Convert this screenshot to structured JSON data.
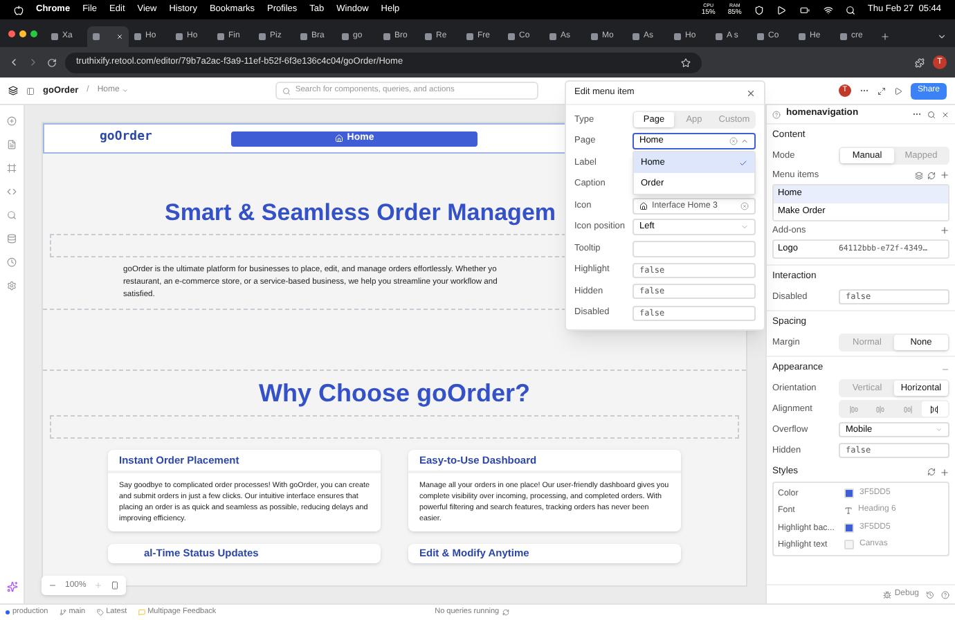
{
  "menubar": {
    "app": "Chrome",
    "menus": [
      "File",
      "Edit",
      "View",
      "History",
      "Bookmarks",
      "Profiles",
      "Tab",
      "Window",
      "Help"
    ],
    "cpu_label": "CPU",
    "cpu": "15%",
    "ram_label": "RAM",
    "ram": "85%",
    "clock": "Thu Feb 27  05:44"
  },
  "tabs": [
    {
      "label": "Xa",
      "selected": false
    },
    {
      "selected": true
    },
    {
      "label": "Ho",
      "selected": false
    },
    {
      "label": "Ho",
      "selected": false
    },
    {
      "label": "Fin",
      "selected": false
    },
    {
      "label": "Piz",
      "selected": false
    },
    {
      "label": "Bra",
      "selected": false
    },
    {
      "label": "go",
      "selected": false
    },
    {
      "label": "Bro",
      "selected": false
    },
    {
      "label": "Re",
      "selected": false
    },
    {
      "label": "Fre",
      "selected": false
    },
    {
      "label": "Co",
      "selected": false
    },
    {
      "label": "As",
      "selected": false
    },
    {
      "label": "Mo",
      "selected": false
    },
    {
      "label": "As",
      "selected": false
    },
    {
      "label": "Ho",
      "selected": false
    },
    {
      "label": "A s",
      "selected": false
    },
    {
      "label": "Co",
      "selected": false
    },
    {
      "label": "He",
      "selected": false
    },
    {
      "label": "cre",
      "selected": false
    }
  ],
  "address": "truthixify.retool.com/editor/79b7a2ac-f3a9-11ef-b52f-6f3e136c4c04/goOrder/Home",
  "profile_initial": "T",
  "editor": {
    "app_name": "goOrder",
    "separator": "/",
    "page": "Home",
    "search_placeholder": "Search for components, queries, and actions",
    "user_initial": "T",
    "share": "Share"
  },
  "canvas": {
    "logo": "goOrder",
    "nav_button": "Home",
    "hero_title": "Smart & Seamless Order Managem",
    "intro_lines": [
      "goOrder is the ultimate platform for businesses to place, edit, and manage orders effortlessly. Whether yo",
      "restaurant, an e-commerce store, or a service-based business, we help you streamline your workflow and",
      "satisfied."
    ],
    "section_title": "Why Choose goOrder?",
    "cards": [
      {
        "title": "Instant Order Placement",
        "body": "Say goodbye to complicated order processes! With goOrder, you can create and submit orders in just a few clicks. Our intuitive interface ensures that placing an order is as quick and seamless as possible, reducing delays and improving efficiency."
      },
      {
        "title": "Easy-to-Use Dashboard",
        "body": "Manage all your orders in one place! Our user-friendly dashboard gives you complete visibility over incoming, processing, and completed orders. With powerful filtering and search features, tracking orders has never been easier."
      }
    ],
    "next_cards": [
      "al-Time Status Updates",
      "Edit & Modify Anytime"
    ],
    "zoom": "100%"
  },
  "popup": {
    "title": "Edit menu item",
    "fields": [
      {
        "kind": "segmented",
        "label": "Type",
        "options": [
          {
            "label": "Page",
            "selected": true
          },
          {
            "label": "App",
            "selected": false
          },
          {
            "label": "Custom",
            "selected": false
          }
        ]
      },
      {
        "kind": "combo",
        "label": "Page",
        "value": "Home",
        "expanded": true,
        "options": [
          {
            "label": "Home",
            "selected": true
          },
          {
            "label": "Order",
            "selected": false
          }
        ]
      },
      {
        "kind": "covered",
        "label": "Label"
      },
      {
        "kind": "covered",
        "label": "Caption"
      },
      {
        "kind": "icon",
        "label": "Icon",
        "value": "Interface Home 3"
      },
      {
        "kind": "select",
        "label": "Icon position",
        "value": "Left"
      },
      {
        "kind": "input",
        "label": "Tooltip"
      },
      {
        "kind": "code",
        "label": "Highlight",
        "value": "false"
      },
      {
        "kind": "code",
        "label": "Hidden",
        "value": "false"
      },
      {
        "kind": "code",
        "label": "Disabled",
        "value": "false"
      }
    ]
  },
  "inspector": {
    "component": "homenavigation",
    "content": {
      "heading": "Content",
      "mode_label": "Mode",
      "mode_options": [
        {
          "label": "Manual",
          "selected": true
        },
        {
          "label": "Mapped",
          "selected": false
        }
      ],
      "menu_items_label": "Menu items",
      "menu_items": [
        {
          "label": "Home",
          "selected": true
        },
        {
          "label": "Make Order",
          "selected": false
        }
      ],
      "addons_label": "Add-ons",
      "logo_label": "Logo",
      "logo_value": "64112bbb-e72f-4349…"
    },
    "interaction": {
      "heading": "Interaction",
      "disabled_label": "Disabled",
      "disabled_value": "false"
    },
    "spacing": {
      "heading": "Spacing",
      "margin_label": "Margin",
      "margin_options": [
        {
          "label": "Normal",
          "selected": false
        },
        {
          "label": "None",
          "selected": true
        }
      ]
    },
    "appearance": {
      "heading": "Appearance",
      "orientation_label": "Orientation",
      "orientation_options": [
        {
          "label": "Vertical",
          "selected": false
        },
        {
          "label": "Horizontal",
          "selected": true
        }
      ],
      "alignment_label": "Alignment",
      "alignment_options": [
        {
          "kind": "start",
          "selected": false
        },
        {
          "kind": "center",
          "selected": false
        },
        {
          "kind": "end",
          "selected": false
        },
        {
          "kind": "between",
          "selected": true
        }
      ],
      "overflow_label": "Overflow",
      "overflow_value": "Mobile",
      "hidden_label": "Hidden",
      "hidden_value": "false"
    },
    "styles": {
      "heading": "Styles",
      "rows": [
        {
          "label": "Color",
          "kind": "swatch",
          "color": "#3f5dd5",
          "value": "3F5DD5"
        },
        {
          "label": "Font",
          "kind": "font",
          "value": "Heading 6"
        },
        {
          "label": "Highlight bac...",
          "kind": "swatch",
          "color": "#3f5dd5",
          "value": "3F5DD5"
        },
        {
          "label": "Highlight text",
          "kind": "swatch",
          "color": "#f5f5f5",
          "value": "Canvas"
        }
      ]
    },
    "debug": "Debug"
  },
  "status_bar": {
    "environment": "production",
    "branch": "main",
    "release": "Latest",
    "feedback": "Multipage Feedback",
    "queries": "No queries running"
  }
}
